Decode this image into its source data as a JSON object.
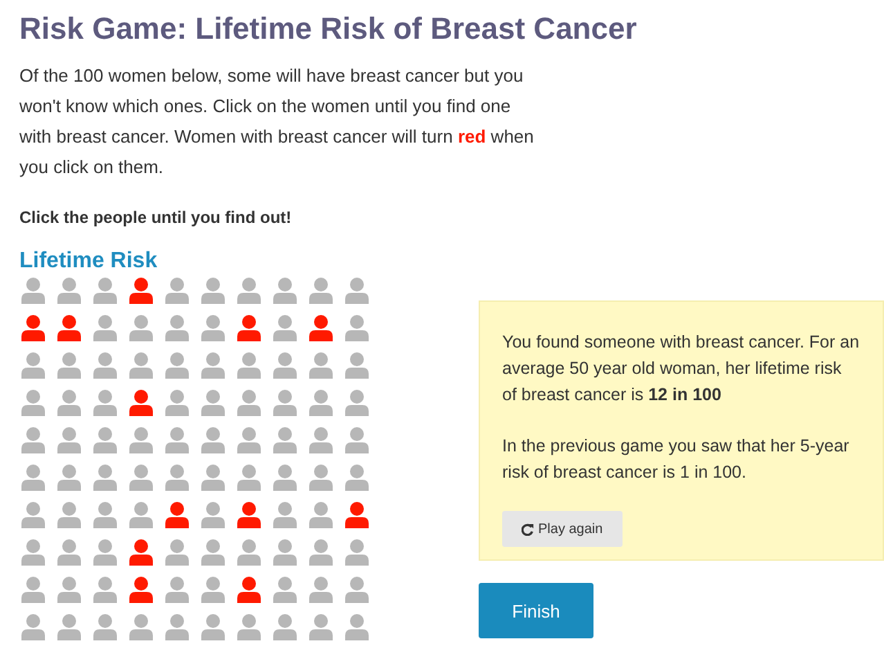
{
  "title": "Risk Game: Lifetime Risk of Breast Cancer",
  "intro": "Of the 100 women below, some will have breast cancer but you won't know which ones. Click on the women until you find one with breast cancer. Women with breast cancer will turn **red** when you click on them.",
  "instruction": "Click the people until you find out!",
  "grid_title": "Lifetime Risk",
  "grid": [
    {
      "people": [
        {
          "cancer": false
        },
        {
          "cancer": false
        },
        {
          "cancer": false
        },
        {
          "cancer": true
        },
        {
          "cancer": false
        },
        {
          "cancer": false
        },
        {
          "cancer": false
        },
        {
          "cancer": false
        },
        {
          "cancer": false
        },
        {
          "cancer": false
        }
      ]
    },
    {
      "people": [
        {
          "cancer": true
        },
        {
          "cancer": true
        },
        {
          "cancer": false
        },
        {
          "cancer": false
        },
        {
          "cancer": false
        },
        {
          "cancer": false
        },
        {
          "cancer": true
        },
        {
          "cancer": false
        },
        {
          "cancer": true
        },
        {
          "cancer": false
        }
      ]
    },
    {
      "people": [
        {
          "cancer": false
        },
        {
          "cancer": false
        },
        {
          "cancer": false
        },
        {
          "cancer": false
        },
        {
          "cancer": false
        },
        {
          "cancer": false
        },
        {
          "cancer": false
        },
        {
          "cancer": false
        },
        {
          "cancer": false
        },
        {
          "cancer": false
        }
      ]
    },
    {
      "people": [
        {
          "cancer": false
        },
        {
          "cancer": false
        },
        {
          "cancer": false
        },
        {
          "cancer": true
        },
        {
          "cancer": false
        },
        {
          "cancer": false
        },
        {
          "cancer": false
        },
        {
          "cancer": false
        },
        {
          "cancer": false
        },
        {
          "cancer": false
        }
      ]
    },
    {
      "people": [
        {
          "cancer": false
        },
        {
          "cancer": false
        },
        {
          "cancer": false
        },
        {
          "cancer": false
        },
        {
          "cancer": false
        },
        {
          "cancer": false
        },
        {
          "cancer": false
        },
        {
          "cancer": false
        },
        {
          "cancer": false
        },
        {
          "cancer": false
        }
      ]
    },
    {
      "people": [
        {
          "cancer": false
        },
        {
          "cancer": false
        },
        {
          "cancer": false
        },
        {
          "cancer": false
        },
        {
          "cancer": false
        },
        {
          "cancer": false
        },
        {
          "cancer": false
        },
        {
          "cancer": false
        },
        {
          "cancer": false
        },
        {
          "cancer": false
        }
      ]
    },
    {
      "people": [
        {
          "cancer": false
        },
        {
          "cancer": false
        },
        {
          "cancer": false
        },
        {
          "cancer": false
        },
        {
          "cancer": true
        },
        {
          "cancer": false
        },
        {
          "cancer": true
        },
        {
          "cancer": false
        },
        {
          "cancer": false
        },
        {
          "cancer": true
        }
      ]
    },
    {
      "people": [
        {
          "cancer": false
        },
        {
          "cancer": false
        },
        {
          "cancer": false
        },
        {
          "cancer": true
        },
        {
          "cancer": false
        },
        {
          "cancer": false
        },
        {
          "cancer": false
        },
        {
          "cancer": false
        },
        {
          "cancer": false
        },
        {
          "cancer": false
        }
      ]
    },
    {
      "people": [
        {
          "cancer": false
        },
        {
          "cancer": false
        },
        {
          "cancer": false
        },
        {
          "cancer": true
        },
        {
          "cancer": false
        },
        {
          "cancer": false
        },
        {
          "cancer": true
        },
        {
          "cancer": false
        },
        {
          "cancer": false
        },
        {
          "cancer": false
        }
      ]
    },
    {
      "people": [
        {
          "cancer": false
        },
        {
          "cancer": false
        },
        {
          "cancer": false
        },
        {
          "cancer": false
        },
        {
          "cancer": false
        },
        {
          "cancer": false
        },
        {
          "cancer": false
        },
        {
          "cancer": false
        },
        {
          "cancer": false
        },
        {
          "cancer": false
        }
      ]
    }
  ],
  "result": {
    "message": "You found someone with breast cancer. For an average 50 year old woman, her lifetime risk of breast cancer is **12 in 100**",
    "comparison": "In the previous game you saw that her 5-year risk of breast cancer is 1 in 100.",
    "play_again": "Play again"
  },
  "finish": "Finish"
}
